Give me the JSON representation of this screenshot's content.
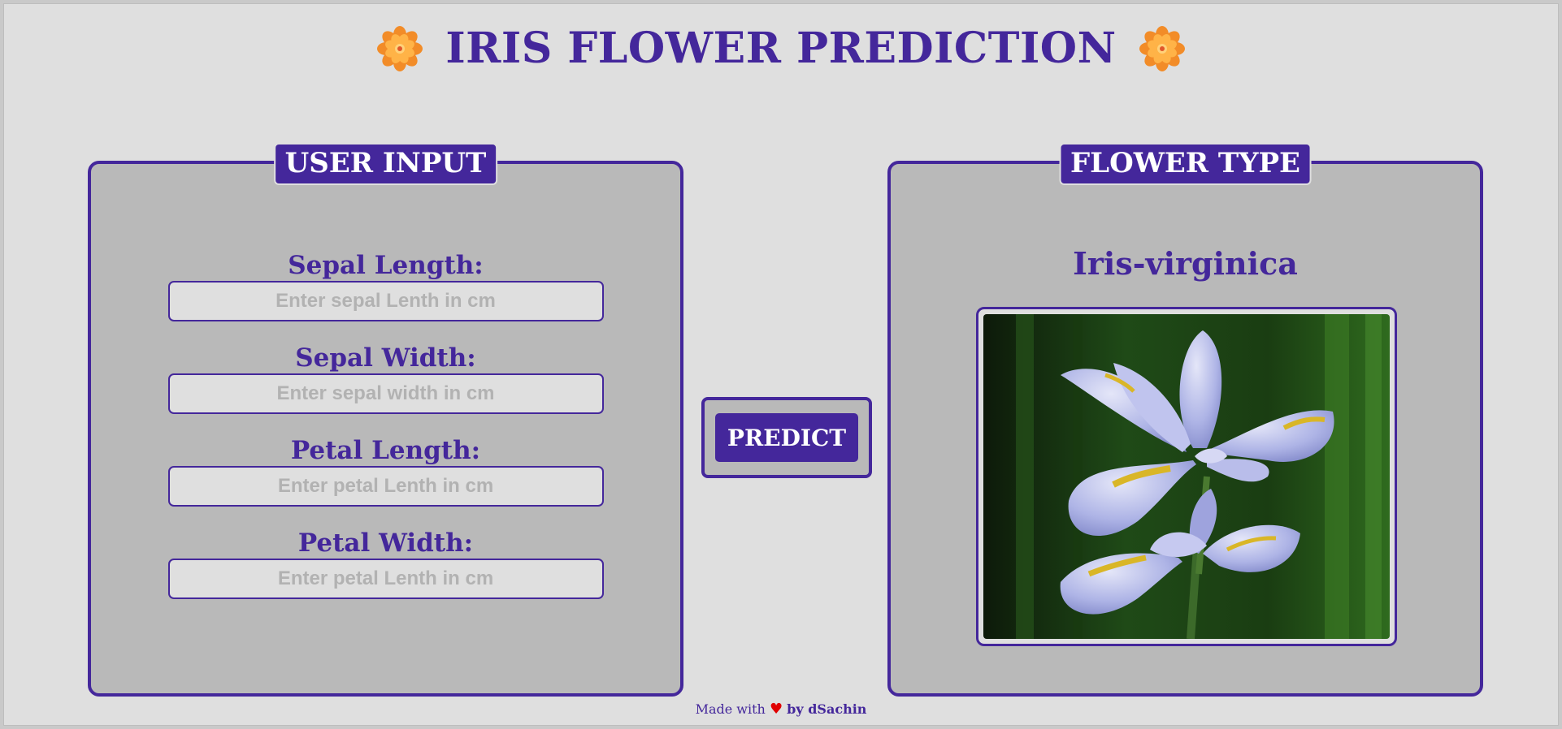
{
  "header": {
    "title": "IRIS FLOWER PREDICTION",
    "left_icon": "flower-icon",
    "right_icon": "flower-icon"
  },
  "user_input": {
    "legend": "USER INPUT",
    "fields": [
      {
        "label": "Sepal Length:",
        "placeholder": "Enter sepal Lenth in cm",
        "value": ""
      },
      {
        "label": "Sepal Width:",
        "placeholder": "Enter sepal width in cm",
        "value": ""
      },
      {
        "label": "Petal Length:",
        "placeholder": "Enter petal Lenth in cm",
        "value": ""
      },
      {
        "label": "Petal Width:",
        "placeholder": "Enter petal Lenth in cm",
        "value": ""
      }
    ]
  },
  "actions": {
    "predict_label": "PREDICT"
  },
  "flower_type": {
    "legend": "FLOWER TYPE",
    "result": "Iris-virginica",
    "image_icon": "iris-flower-photo"
  },
  "footer": {
    "prefix": "Made with",
    "heart": "♥",
    "author": "by dSachin"
  },
  "colors": {
    "accent": "#44279b",
    "background": "#dfdfdf",
    "panel": "#b9b9b9",
    "heart": "#e00000",
    "flower_orange": "#f7a03c"
  }
}
